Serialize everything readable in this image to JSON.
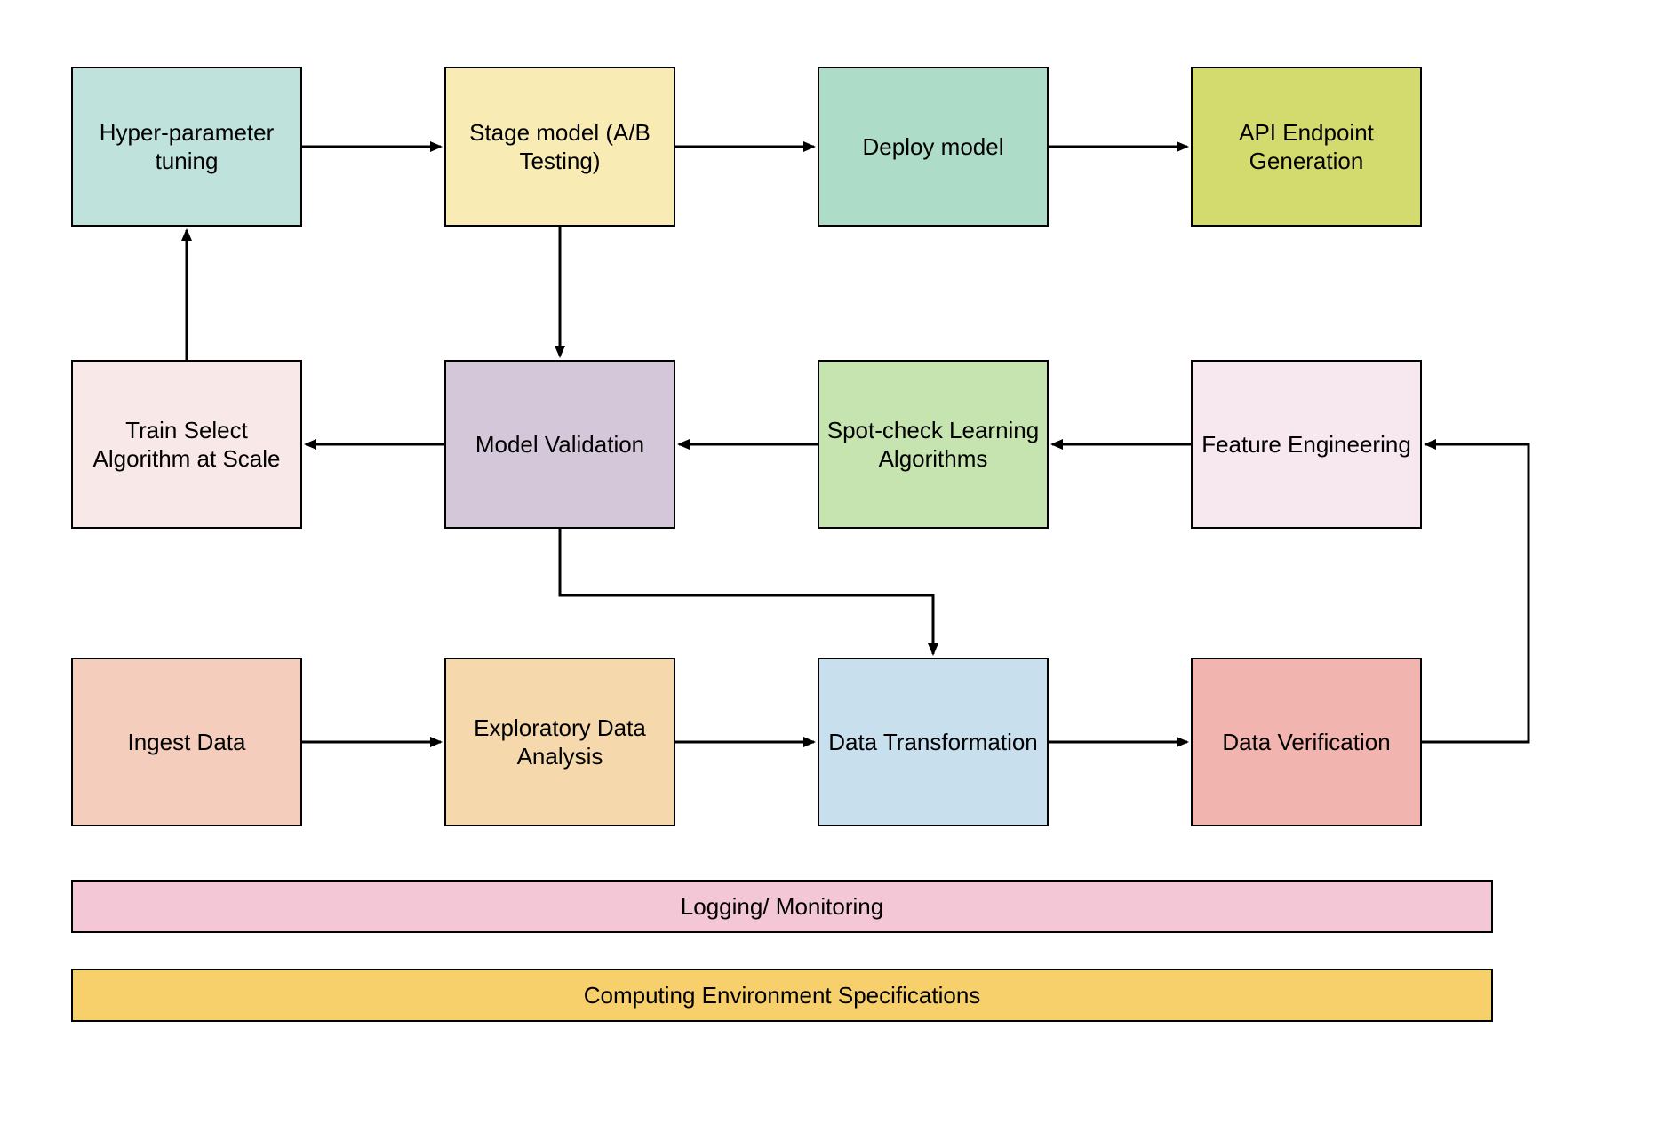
{
  "nodes": {
    "hyper": {
      "label": "Hyper-parameter tuning"
    },
    "stage": {
      "label": "Stage model (A/B Testing)"
    },
    "deploy": {
      "label": "Deploy model"
    },
    "api": {
      "label": "API Endpoint Generation"
    },
    "train": {
      "label": "Train Select Algorithm at Scale"
    },
    "modval": {
      "label": "Model Validation"
    },
    "spot": {
      "label": "Spot-check Learning Algorithms"
    },
    "feat": {
      "label": "Feature Engineering"
    },
    "ingest": {
      "label": "Ingest Data"
    },
    "eda": {
      "label": "Exploratory Data Analysis"
    },
    "xform": {
      "label": "Data Transformation"
    },
    "verify": {
      "label": "Data Verification"
    }
  },
  "bars": {
    "log": {
      "label": "Logging/ Monitoring"
    },
    "env": {
      "label": "Computing Environment Specifications"
    }
  },
  "colors": {
    "hyper": "#BFE3DC",
    "stage": "#F8EBB4",
    "deploy": "#ADDCC8",
    "api": "#D3DA6E",
    "train": "#F8E8E8",
    "modval": "#D4C7D9",
    "spot": "#C6E4AF",
    "feat": "#F7E7EF",
    "ingest": "#F4CDBC",
    "eda": "#F5D9AC",
    "xform": "#C8DFEE",
    "verify": "#F2B4AE",
    "log": "#F4C7D7",
    "env": "#F7CF6B"
  }
}
